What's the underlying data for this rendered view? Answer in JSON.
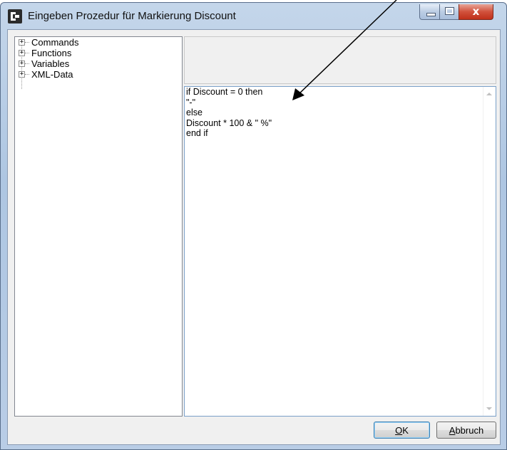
{
  "window": {
    "title": "Eingeben Prozedur für Markierung Discount",
    "close_glyph": "x"
  },
  "tree": {
    "items": [
      {
        "label": "Commands",
        "expander": "+"
      },
      {
        "label": "Functions",
        "expander": "+"
      },
      {
        "label": "Variables",
        "expander": "+"
      },
      {
        "label": "XML-Data",
        "expander": "+"
      }
    ]
  },
  "editor": {
    "code": "if Discount = 0 then\n\"-\"\nelse\nDiscount * 100 & \" %\"\nend if"
  },
  "buttons": {
    "ok_hotkey": "O",
    "ok_rest": "K",
    "cancel_hotkey": "A",
    "cancel_rest": "bbruch"
  },
  "colors": {
    "close_button": "#c7402a",
    "ok_focus_border": "#3c7fb1"
  }
}
